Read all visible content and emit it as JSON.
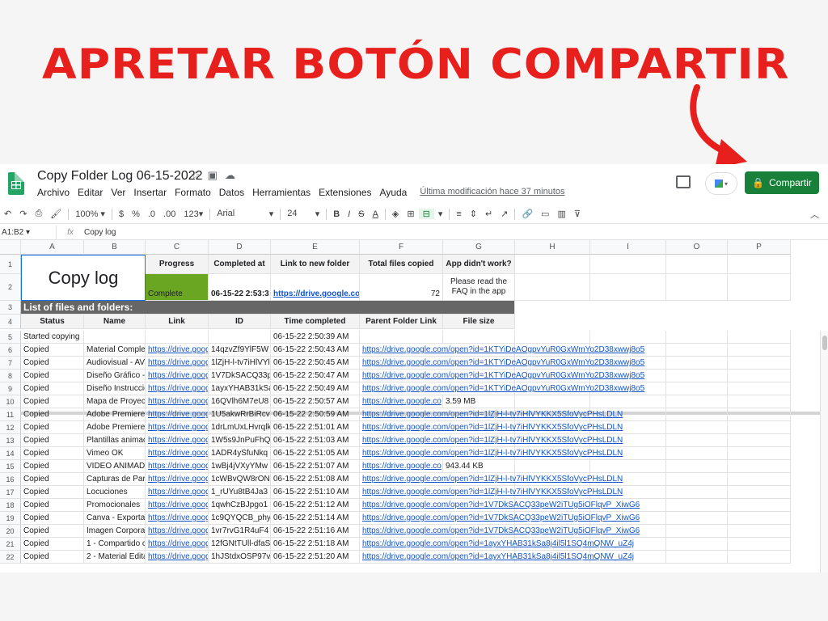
{
  "headline": "APRETAR BOTÓN COMPARTIR",
  "colors": {
    "headline": "#e8201d",
    "share": "#188038",
    "complete": "#6aa621",
    "link": "#1155cc"
  },
  "sheet": {
    "title": "Copy Folder Log 06-15-2022",
    "menu": [
      "Archivo",
      "Editar",
      "Ver",
      "Insertar",
      "Formato",
      "Datos",
      "Herramientas",
      "Extensiones",
      "Ayuda"
    ],
    "last_modified": "Última modificación hace 37 minutos",
    "share_label": "Compartir",
    "toolbar": {
      "zoom": "100%",
      "currency": "$",
      "percent": "%",
      "dec_less": ".0",
      "dec_more": ".00",
      "more_formats": "123",
      "font": "Arial",
      "font_size": "24"
    },
    "name_box": "A1:B2",
    "fx": "fx",
    "formula": "Copy log"
  },
  "columns": [
    "A",
    "B",
    "C",
    "D",
    "E",
    "F",
    "G",
    "H",
    "I",
    "O",
    "P"
  ],
  "cells": {
    "copy_log": "Copy log",
    "progress_h": "Progress",
    "completed_h": "Completed at",
    "link_h": "Link to new folder",
    "total_h": "Total files copied",
    "app_h": "App didn't work?",
    "progress": "Complete",
    "completed_at": "06-15-22 2:53:3",
    "new_folder_link": "https://drive.google.co",
    "total": "72",
    "app_note": "Please read the FAQ in the app",
    "list_title": "List of files and folders:",
    "hdr": [
      "Status",
      "Name",
      "Link",
      "ID",
      "Time completed",
      "Parent Folder Link",
      "File size"
    ]
  },
  "rows": [
    {
      "n": "5",
      "status": "Started copying",
      "name": "",
      "link": "",
      "id": "",
      "time": "06-15-22 2:50:39 AM",
      "parent": "",
      "size": ""
    },
    {
      "n": "6",
      "status": "Copied",
      "name": "Material Comple",
      "link": "https://drive.goog",
      "id": "14qzvZf9YlF5W",
      "time": "06-15-22 2:50:43 AM",
      "parent": "https://drive.google.com/open?id=1KTYiDeAOgpvYuR0GxWmYo2D38xwwj8o5",
      "size": ""
    },
    {
      "n": "7",
      "status": "Copied",
      "name": "Audiovisual - AV",
      "link": "https://drive.goog",
      "id": "1lZjH-l-tv7iHlVYl",
      "time": "06-15-22 2:50:45 AM",
      "parent": "https://drive.google.com/open?id=1KTYiDeAOgpvYuR0GxWmYo2D38xwwj8o5",
      "size": ""
    },
    {
      "n": "8",
      "status": "Copied",
      "name": "Diseño Gráfico -",
      "link": "https://drive.goog",
      "id": "1V7DkSACQ33p",
      "time": "06-15-22 2:50:47 AM",
      "parent": "https://drive.google.com/open?id=1KTYiDeAOgpvYuR0GxWmYo2D38xwwj8o5",
      "size": ""
    },
    {
      "n": "9",
      "status": "Copied",
      "name": "Diseño Instruccio",
      "link": "https://drive.goog",
      "id": "1ayxYHAB31kSa",
      "time": "06-15-22 2:50:49 AM",
      "parent": "https://drive.google.com/open?id=1KTYiDeAOgpvYuR0GxWmYo2D38xwwj8o5",
      "size": ""
    },
    {
      "n": "10",
      "status": "Copied",
      "name": "Mapa de Proyec",
      "link": "https://drive.goog",
      "id": "16QVlh6M7eU8",
      "time": "06-15-22 2:50:57 AM",
      "parent": "https://drive.google.co",
      "size": "3.59 MB"
    },
    {
      "n": "11",
      "status": "Copied",
      "name": "Adobe Premiere",
      "link": "https://drive.goog",
      "id": "1U5akwRrBiRcv",
      "time": "06-15-22 2:50:59 AM",
      "parent": "https://drive.google.com/open?id=1lZjH-l-tv7iHlVYKKX5SfoVycPHsLDLN",
      "size": ""
    },
    {
      "n": "12",
      "status": "Copied",
      "name": "Adobe Premiere",
      "link": "https://drive.goog",
      "id": "1drLmUxLHvrqlk",
      "time": "06-15-22 2:51:01 AM",
      "parent": "https://drive.google.com/open?id=1lZjH-l-tv7iHlVYKKX5SfoVycPHsLDLN",
      "size": ""
    },
    {
      "n": "13",
      "status": "Copied",
      "name": "Plantillas animac",
      "link": "https://drive.goog",
      "id": "1W5s9JnPuFhQ",
      "time": "06-15-22 2:51:03 AM",
      "parent": "https://drive.google.com/open?id=1lZjH-l-tv7iHlVYKKX5SfoVycPHsLDLN",
      "size": ""
    },
    {
      "n": "14",
      "status": "Copied",
      "name": "Vimeo OK",
      "link": "https://drive.goog",
      "id": "1ADR4ySfuNkq",
      "time": "06-15-22 2:51:05 AM",
      "parent": "https://drive.google.com/open?id=1lZjH-l-tv7iHlVYKKX5SfoVycPHsLDLN",
      "size": ""
    },
    {
      "n": "15",
      "status": "Copied",
      "name": "VIDEO ANIMAD",
      "link": "https://drive.goog",
      "id": "1wBj4jVXyYMw",
      "time": "06-15-22 2:51:07 AM",
      "parent": "https://drive.google.co",
      "size": "943.44 KB"
    },
    {
      "n": "16",
      "status": "Copied",
      "name": "Capturas de Par",
      "link": "https://drive.goog",
      "id": "1cWBvQW8rON",
      "time": "06-15-22 2:51:08 AM",
      "parent": "https://drive.google.com/open?id=1lZjH-l-tv7iHlVYKKX5SfoVycPHsLDLN",
      "size": ""
    },
    {
      "n": "17",
      "status": "Copied",
      "name": "Locuciones",
      "link": "https://drive.goog",
      "id": "1_rUYu8tB4Ja3",
      "time": "06-15-22 2:51:10 AM",
      "parent": "https://drive.google.com/open?id=1lZjH-l-tv7iHlVYKKX5SfoVycPHsLDLN",
      "size": ""
    },
    {
      "n": "18",
      "status": "Copied",
      "name": "Promocionales",
      "link": "https://drive.goog",
      "id": "1qwhCzBJpgo1",
      "time": "06-15-22 2:51:12 AM",
      "parent": "https://drive.google.com/open?id=1V7DkSACQ33peW2iTUg5iOFlqvP_XiwG6",
      "size": ""
    },
    {
      "n": "19",
      "status": "Copied",
      "name": "Canva - Exporta",
      "link": "https://drive.goog",
      "id": "1c9QYQCB_phy",
      "time": "06-15-22 2:51:14 AM",
      "parent": "https://drive.google.com/open?id=1V7DkSACQ33peW2iTUg5iOFlqvP_XiwG6",
      "size": ""
    },
    {
      "n": "20",
      "status": "Copied",
      "name": "Imagen Corpora",
      "link": "https://drive.goog",
      "id": "1vr7rvG1R4uF4",
      "time": "06-15-22 2:51:16 AM",
      "parent": "https://drive.google.com/open?id=1V7DkSACQ33peW2iTUg5iOFlqvP_XiwG6",
      "size": ""
    },
    {
      "n": "21",
      "status": "Copied",
      "name": "1 - Compartido c",
      "link": "https://drive.goog",
      "id": "12fGNtTUll-dfaS",
      "time": "06-15-22 2:51:18 AM",
      "parent": "https://drive.google.com/open?id=1ayxYHAB31kSa8j4il5l1SQ4mQNW_uZ4j",
      "size": ""
    },
    {
      "n": "22",
      "status": "Copied",
      "name": "2 - Material Edita",
      "link": "https://drive.goog",
      "id": "1hJStdxOSP97v",
      "time": "06-15-22 2:51:20 AM",
      "parent": "https://drive.google.com/open?id=1ayxYHAB31kSa8j4il5l1SQ4mQNW_uZ4j",
      "size": ""
    }
  ]
}
